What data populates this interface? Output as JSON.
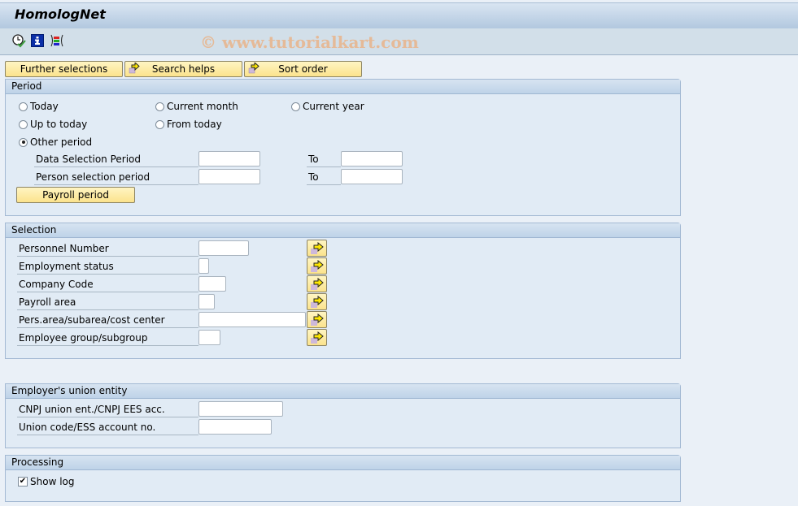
{
  "window": {
    "title": "HomologNet"
  },
  "toolbar": {
    "icons": [
      {
        "name": "execute-clock-icon"
      },
      {
        "name": "info-icon"
      },
      {
        "name": "selection-options-icon"
      }
    ],
    "watermark": "© www.tutorialkart.com"
  },
  "buttons": {
    "further_selections": "Further selections",
    "search_helps": "Search helps",
    "sort_order": "Sort order"
  },
  "period": {
    "title": "Period",
    "options": [
      {
        "label": "Today",
        "selected": false
      },
      {
        "label": "Current month",
        "selected": false
      },
      {
        "label": "Current year",
        "selected": false
      },
      {
        "label": "Up to today",
        "selected": false
      },
      {
        "label": "From today",
        "selected": false
      },
      {
        "label": "Other period",
        "selected": true
      }
    ],
    "data_selection_label": "Data Selection Period",
    "data_selection_from": "",
    "data_selection_to": "",
    "person_selection_label": "Person selection period",
    "person_selection_from": "",
    "person_selection_to": "",
    "to_label": "To",
    "payroll_period_button": "Payroll period"
  },
  "selection": {
    "title": "Selection",
    "fields": [
      {
        "label": "Personnel Number",
        "value": ""
      },
      {
        "label": "Employment status",
        "value": ""
      },
      {
        "label": "Company Code",
        "value": ""
      },
      {
        "label": "Payroll area",
        "value": ""
      },
      {
        "label": "Pers.area/subarea/cost center",
        "value": ""
      },
      {
        "label": "Employee group/subgroup",
        "value": ""
      }
    ]
  },
  "union": {
    "title": "Employer's union entity",
    "fields": [
      {
        "label": "CNPJ union ent./CNPJ EES acc.",
        "value": ""
      },
      {
        "label": "Union code/ESS account no.",
        "value": ""
      }
    ]
  },
  "processing": {
    "title": "Processing",
    "show_log_label": "Show log",
    "show_log_checked": true
  },
  "colors": {
    "button_yellow": "#fbe38c",
    "header_blue": "#bed3e8",
    "background": "#eaf0f7"
  }
}
